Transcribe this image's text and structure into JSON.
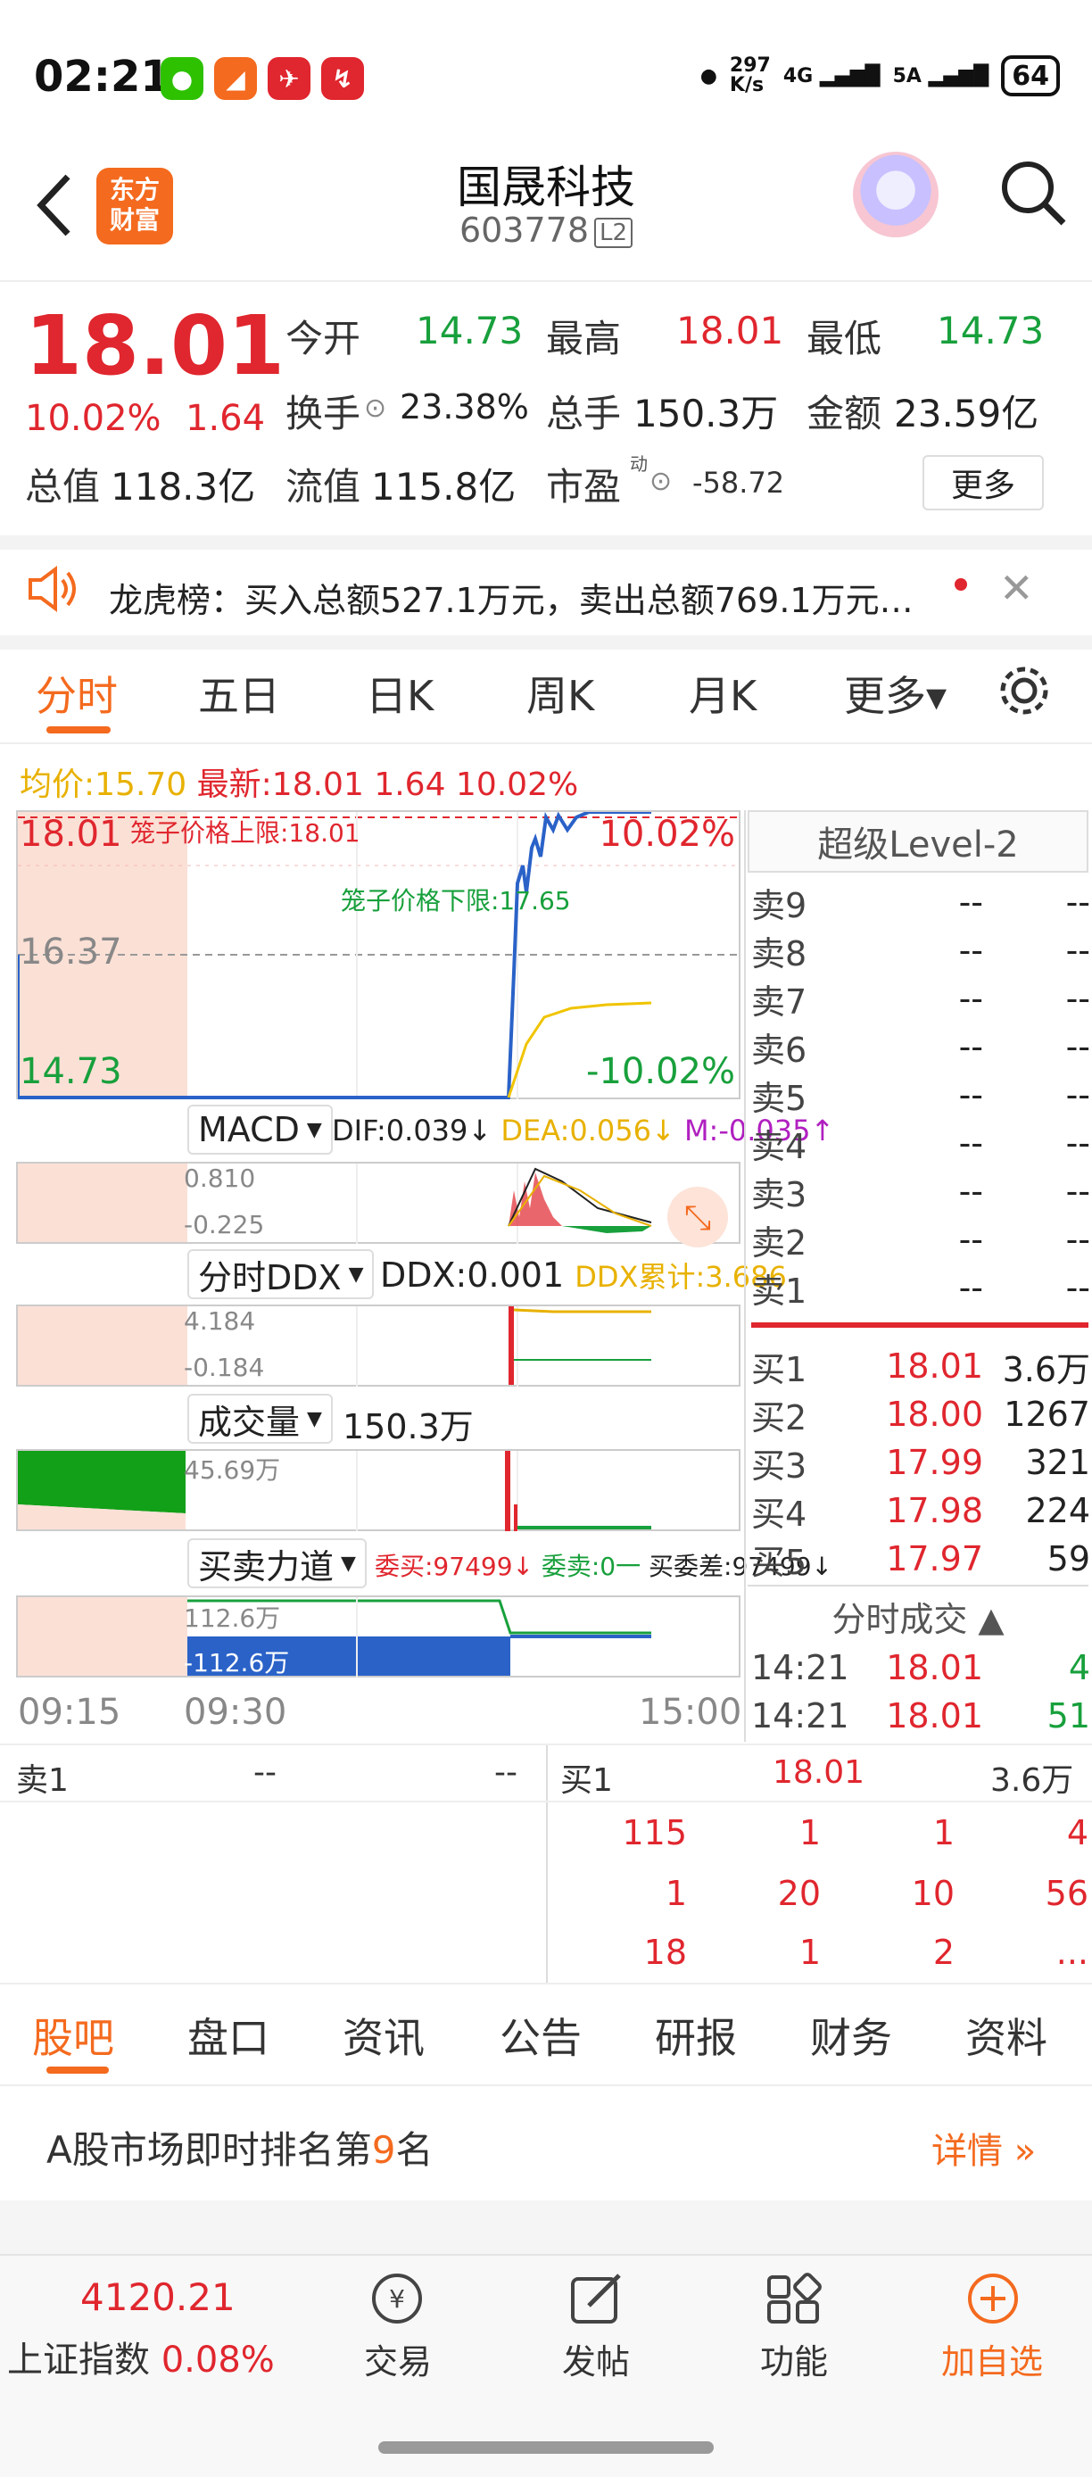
{
  "status": {
    "time": "02:21",
    "net_speed_top": "297",
    "net_speed_bottom": "K/s",
    "net1": "4G",
    "net2": "5A",
    "battery": "64"
  },
  "header": {
    "name": "国晟科技",
    "code": "603778",
    "level_badge": "L2",
    "logo_text": "东方\n财富"
  },
  "quote": {
    "price": "18.01",
    "pct": "10.02%",
    "chg": "1.64",
    "open_lbl": "今开",
    "open": "14.73",
    "high_lbl": "最高",
    "high": "18.01",
    "low_lbl": "最低",
    "low": "14.73",
    "turnover_lbl": "换手",
    "turnover": "23.38%",
    "vol_lbl": "总手",
    "vol": "150.3万",
    "amt_lbl": "金额",
    "amt": "23.59亿",
    "mcap_lbl": "总值",
    "mcap": "118.3亿",
    "float_lbl": "流值",
    "float": "115.8亿",
    "pe_lbl": "市盈",
    "pe_sup": "动",
    "pe": "-58.72",
    "more": "更多"
  },
  "notice": {
    "text": "龙虎榜：买入总额527.1万元，卖出总额769.1万元…"
  },
  "ktabs": [
    "分时",
    "五日",
    "日K",
    "周K",
    "月K",
    "更多▾"
  ],
  "chart": {
    "avg_lbl": "均价:",
    "avg": "15.70",
    "latest_lbl": "最新:",
    "latest": "18.01",
    "latest_chg": "1.64",
    "latest_pct": "10.02%",
    "top_left": "18.01",
    "mid_left": "16.37",
    "bot_left": "14.73",
    "top_right": "10.02%",
    "bot_right": "-10.02%",
    "upper_limit": "笼子价格上限:18.01",
    "lower_limit": "笼子价格下限:17.65",
    "times": [
      "09:15",
      "09:30",
      "15:00"
    ]
  },
  "macd": {
    "btn": "MACD",
    "dif": "DIF:0.039↓",
    "dea": "DEA:0.056↓",
    "m": "M:-0.035↑",
    "v1": "0.810",
    "v2": "-0.225"
  },
  "ddx": {
    "btn": "分时DDX",
    "ddx": "DDX:0.001",
    "cum": "DDX累计:3.686",
    "v1": "4.184",
    "v2": "-0.184"
  },
  "volume": {
    "btn": "成交量",
    "val": "150.3万",
    "v1": "45.69万"
  },
  "force": {
    "btn": "买卖力道",
    "wb": "委买:97499↓",
    "ws": "委卖:0一",
    "diff": "买委差:97499↓",
    "v1": "112.6万",
    "v2": "-112.6万"
  },
  "level2": {
    "title": "超级Level-2",
    "sells": [
      [
        "卖9",
        "--",
        "--"
      ],
      [
        "卖8",
        "--",
        "--"
      ],
      [
        "卖7",
        "--",
        "--"
      ],
      [
        "卖6",
        "--",
        "--"
      ],
      [
        "卖5",
        "--",
        "--"
      ],
      [
        "卖4",
        "--",
        "--"
      ],
      [
        "卖3",
        "--",
        "--"
      ],
      [
        "卖2",
        "--",
        "--"
      ],
      [
        "卖1",
        "--",
        "--"
      ]
    ],
    "buys": [
      [
        "买1",
        "18.01",
        "3.6万"
      ],
      [
        "买2",
        "18.00",
        "1267"
      ],
      [
        "买3",
        "17.99",
        "321"
      ],
      [
        "买4",
        "17.98",
        "224"
      ],
      [
        "买5",
        "17.97",
        "59"
      ]
    ],
    "ticks_title": "分时成交",
    "ticks": [
      [
        "14:21",
        "18.01",
        "4"
      ],
      [
        "14:21",
        "18.01",
        "51"
      ]
    ]
  },
  "queue": {
    "sell1": [
      "卖1",
      "--",
      "--"
    ],
    "buy1": [
      "买1",
      "18.01",
      "3.6万"
    ],
    "rows": [
      [
        "115",
        "1",
        "1",
        "4"
      ],
      [
        "1",
        "20",
        "10",
        "56"
      ],
      [
        "18",
        "1",
        "2",
        "..."
      ]
    ]
  },
  "btabs": [
    "股吧",
    "盘口",
    "资讯",
    "公告",
    "研报",
    "财务",
    "资料"
  ],
  "rank": {
    "pre": "A股市场即时排名第",
    "num": "9",
    "post": "名",
    "detail": "详情"
  },
  "bottom": {
    "index_val": "4120.21",
    "index_name": "上证指数",
    "index_pct": "0.08%",
    "trade": "交易",
    "post": "发帖",
    "func": "功能",
    "add": "加自选"
  }
}
